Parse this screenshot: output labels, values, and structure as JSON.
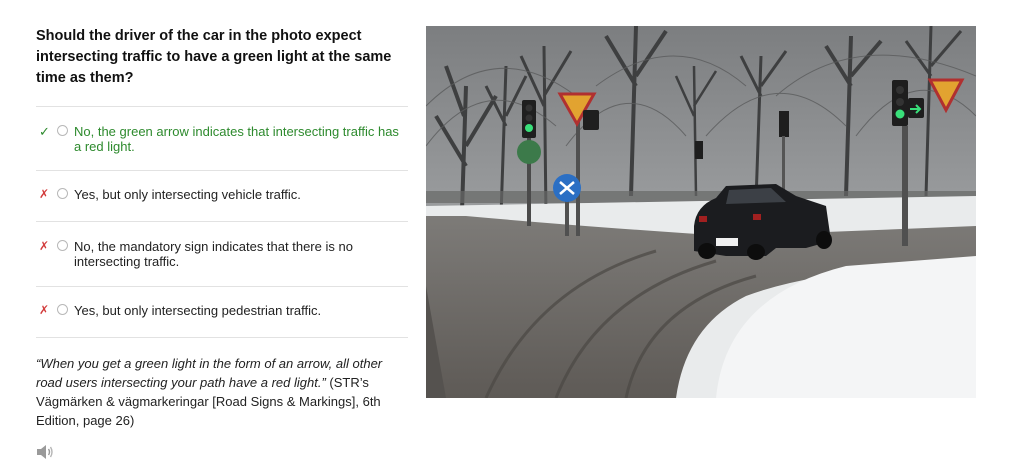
{
  "question": "Should the driver of the car in the photo expect intersecting traffic to have a green light at the same time as them?",
  "options": [
    {
      "status": "correct",
      "mark": "✓",
      "text": "No, the green arrow indicates that intersecting traffic has a red light."
    },
    {
      "status": "wrong",
      "mark": "✗",
      "text": "Yes, but only intersecting vehicle traffic."
    },
    {
      "status": "wrong",
      "mark": "✗",
      "text": "No, the mandatory sign indicates that there is no intersecting traffic."
    },
    {
      "status": "wrong",
      "mark": "✗",
      "text": "Yes, but only intersecting pedestrian traffic."
    }
  ],
  "explanation": {
    "quote": "“When you get a green light in the form of an arrow, all other road users intersecting your path have a red light.”",
    "source": " (STR’s Vägmärken & vägmarkeringar [Road Signs & Markings], 6th Edition, page 26)"
  },
  "icons": {
    "speaker": "speaker-icon"
  },
  "colors": {
    "correct": "#2d8a2d",
    "wrong": "#d23b3b",
    "green_light": "#39e07a"
  }
}
